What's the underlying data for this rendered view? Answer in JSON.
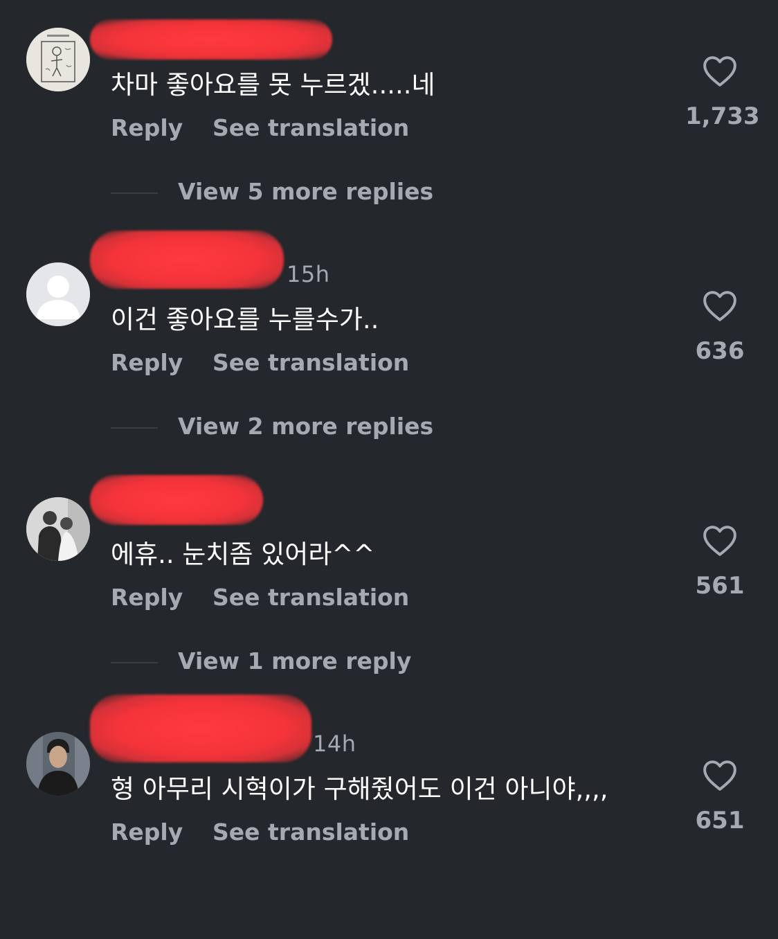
{
  "colors": {
    "background": "#24272b",
    "secondary_text": "#a5aab1",
    "primary_text": "#ffffff",
    "redaction": "#f4343a"
  },
  "icons": {
    "like": "heart-outline-icon",
    "default_avatar": "person-silhouette-icon"
  },
  "comments": [
    {
      "timestamp": "",
      "text": "차마 좋아요를 못 누르겠.....네",
      "reply_label": "Reply",
      "translate_label": "See translation",
      "like_count": "1,733",
      "view_more_label": "View 5 more replies"
    },
    {
      "timestamp": "15h",
      "text": "이건 좋아요를 누를수가..",
      "reply_label": "Reply",
      "translate_label": "See translation",
      "like_count": "636",
      "view_more_label": "View 2 more replies"
    },
    {
      "timestamp": "",
      "text": "에휴.. 눈치좀 있어라^^",
      "reply_label": "Reply",
      "translate_label": "See translation",
      "like_count": "561",
      "view_more_label": "View 1 more reply"
    },
    {
      "timestamp": "14h",
      "text": "형 아무리 시혁이가 구해줬어도 이건 아니야,,,,",
      "reply_label": "Reply",
      "translate_label": "See translation",
      "like_count": "651",
      "view_more_label": ""
    }
  ]
}
